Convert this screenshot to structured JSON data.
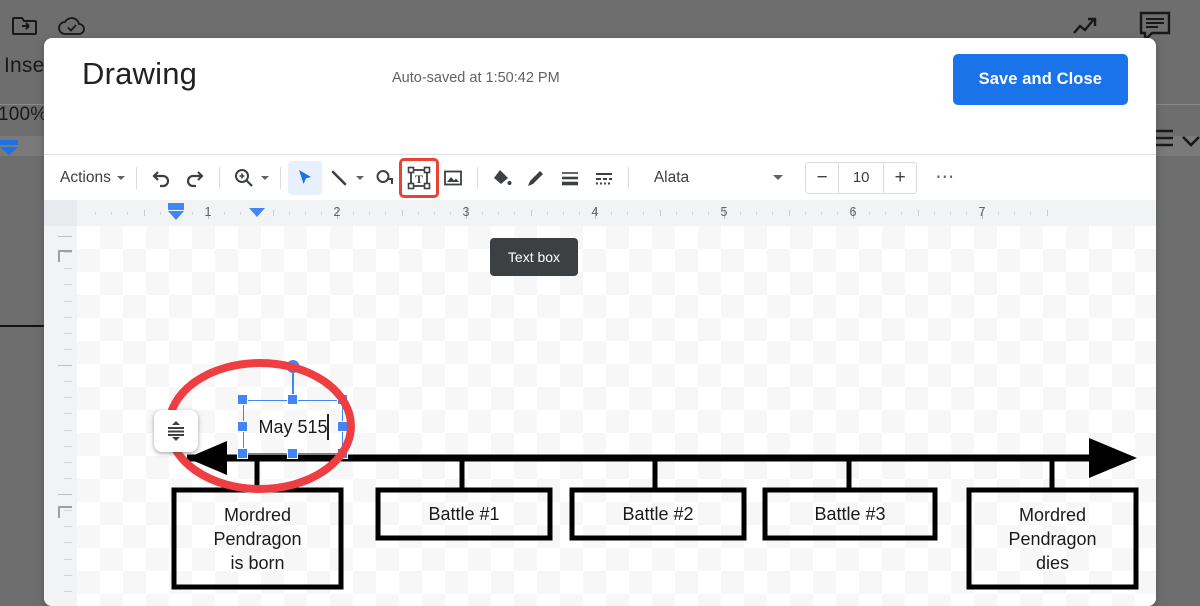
{
  "background_app": {
    "name": "google-docs",
    "menu_label": "Inse",
    "zoom_label": "100%",
    "icons": [
      "move-to-folder-icon",
      "cloud-saved-icon",
      "trending-up-icon",
      "comment-icon",
      "list-icon",
      "chevron-down-icon"
    ]
  },
  "dialog": {
    "title": "Drawing",
    "autosave_status": "Auto-saved at 1:50:42 PM",
    "save_close_label": "Save and Close"
  },
  "toolbar": {
    "actions_label": "Actions",
    "items": [
      {
        "name": "undo-icon",
        "tooltip": "Undo"
      },
      {
        "name": "redo-icon",
        "tooltip": "Redo"
      },
      {
        "name": "zoom-icon",
        "tooltip": "Zoom"
      },
      {
        "name": "select-arrow-icon",
        "tooltip": "Select",
        "active": true
      },
      {
        "name": "line-icon",
        "tooltip": "Line"
      },
      {
        "name": "shape-icon",
        "tooltip": "Shape"
      },
      {
        "name": "text-box-icon",
        "tooltip": "Text box",
        "highlighted": true
      },
      {
        "name": "image-icon",
        "tooltip": "Image"
      },
      {
        "name": "fill-color-icon",
        "tooltip": "Fill color"
      },
      {
        "name": "line-color-icon",
        "tooltip": "Line color"
      },
      {
        "name": "line-weight-icon",
        "tooltip": "Line weight"
      },
      {
        "name": "line-dash-icon",
        "tooltip": "Line dash"
      }
    ],
    "font_name": "Alata",
    "font_size": "10",
    "decrease_label": "−",
    "increase_label": "+",
    "more_label": "⋯",
    "active_tooltip": "Text box",
    "accent_color": "#1a73e8",
    "highlight_color": "#ea4335"
  },
  "ruler": {
    "horizontal_numbers": [
      "1",
      "2",
      "3",
      "4",
      "5",
      "6",
      "7"
    ],
    "unit": "inches"
  },
  "canvas": {
    "selected_textbox": {
      "text": "May 515",
      "has_caret": true,
      "selection_color": "#4285f4"
    },
    "vertical_align_button": "vertical-align-icon",
    "annotation": {
      "type": "ellipse",
      "color": "#ef3e42"
    },
    "timeline": {
      "title": "timeline-diagram",
      "arrow_color": "#000000",
      "events": [
        {
          "label": "Mordred\nPendragon\nis born",
          "lines": [
            "Mordred",
            "Pendragon",
            "is born"
          ]
        },
        {
          "label": "Battle #1",
          "lines": [
            "Battle #1"
          ]
        },
        {
          "label": "Battle #2",
          "lines": [
            "Battle #2"
          ]
        },
        {
          "label": "Battle #3",
          "lines": [
            "Battle #3"
          ]
        },
        {
          "label": "Mordred\nPendragon\ndies",
          "lines": [
            "Mordred",
            "Pendragon",
            "dies"
          ]
        }
      ]
    }
  }
}
